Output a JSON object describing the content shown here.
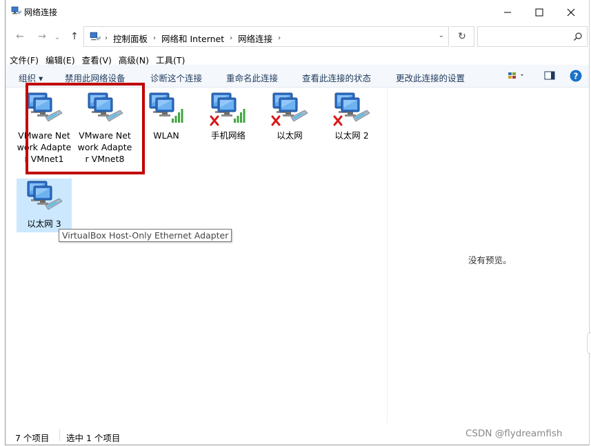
{
  "window": {
    "title": "网络连接",
    "icon": "network-connections-icon",
    "controls": {
      "minimize": "minimize-icon",
      "maximize": "maximize-icon",
      "close": "close-icon"
    }
  },
  "nav": {
    "back": "←",
    "forward": "→",
    "recent": "⌄",
    "up": "↑",
    "breadcrumbs": [
      "控制面板",
      "网络和 Internet",
      "网络连接"
    ],
    "refresh": "↻"
  },
  "menubar": [
    "文件(F)",
    "编辑(E)",
    "查看(V)",
    "高级(N)",
    "工具(T)"
  ],
  "commands": {
    "organize": "组织 ▾",
    "disable": "禁用此网络设备",
    "diagnose": "诊断这个连接",
    "rename": "重命名此连接",
    "status": "查看此连接的状态",
    "settings": "更改此连接的设置"
  },
  "items": [
    {
      "label": "VMware Network Adapter VMnet1",
      "status": "ok"
    },
    {
      "label": "VMware Network Adapter VMnet8",
      "status": "ok"
    },
    {
      "label": "WLAN",
      "status": "wifi"
    },
    {
      "label": "手机网络",
      "status": "wifi-disabled"
    },
    {
      "label": "以太网",
      "status": "disabled"
    },
    {
      "label": "以太网 2",
      "status": "disabled"
    },
    {
      "label": "以太网 3",
      "status": "ok",
      "selected": true
    }
  ],
  "tooltip": "VirtualBox Host-Only Ethernet Adapter",
  "preview": "没有预览。",
  "status": {
    "count": "7 个项目",
    "selected": "选中 1 个项目"
  },
  "watermark": "CSDN @flydreamfish",
  "colors": {
    "highlight": "#c00000",
    "selection": "#cce8ff",
    "command_text": "#1e395b",
    "help": "#1a73c7"
  }
}
